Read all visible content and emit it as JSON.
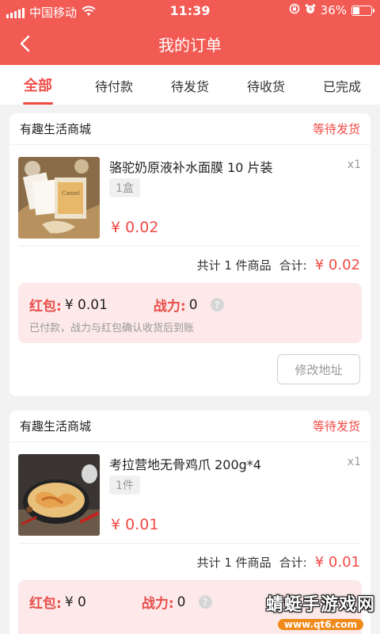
{
  "status_bar": {
    "carrier": "中国移动",
    "time": "11:39",
    "battery": "36%",
    "battery_level": 0.36,
    "icons": [
      "signal-icon",
      "wifi-icon",
      "lock-rotation-icon",
      "alarm-icon",
      "battery-icon"
    ]
  },
  "nav": {
    "title": "我的订单",
    "back_icon": "chevron-left-icon"
  },
  "tabs": [
    {
      "label": "全部",
      "active": true
    },
    {
      "label": "待付款",
      "active": false
    },
    {
      "label": "待发货",
      "active": false
    },
    {
      "label": "待收货",
      "active": false
    },
    {
      "label": "已完成",
      "active": false
    }
  ],
  "orders": [
    {
      "shop": "有趣生活商城",
      "status": "等待发货",
      "product": {
        "name": "骆驼奶原液补水面膜 10 片装",
        "quantity": "x1",
        "spec": "1盒",
        "price": "¥ 0.02"
      },
      "total_count": "共计 1 件商品",
      "total_label": "合计:",
      "total_amount": "¥ 0.02",
      "reward": {
        "red_packet_label": "红包:",
        "red_packet_value": "¥ 0.01",
        "power_label": "战力:",
        "power_value": "0",
        "note": "已付款，战力与红包确认收货后到账"
      },
      "action": "修改地址"
    },
    {
      "shop": "有趣生活商城",
      "status": "等待发货",
      "product": {
        "name": "考拉营地无骨鸡爪 200g*4",
        "quantity": "x1",
        "spec": "1件",
        "price": "¥ 0.01"
      },
      "total_count": "共计 1 件商品",
      "total_label": "合计:",
      "total_amount": "¥ 0.01",
      "reward": {
        "red_packet_label": "红包:",
        "red_packet_value": "¥ 0",
        "power_label": "战力:",
        "power_value": "0"
      }
    }
  ],
  "watermark": {
    "title": "蜻蜓手游戏网",
    "url": "www.qt6.com"
  },
  "colors": {
    "brand": "#f25a54",
    "accent": "#f04a45",
    "reward_bg": "#fde9e9"
  }
}
